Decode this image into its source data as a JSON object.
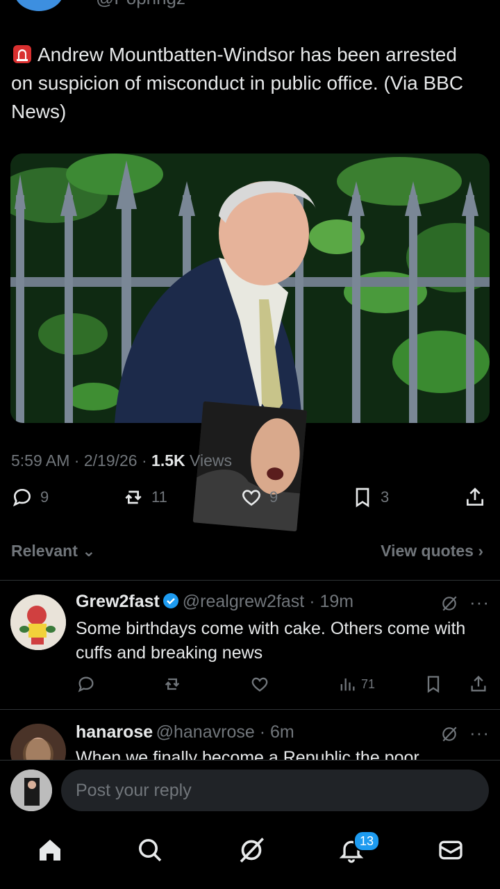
{
  "colors": {
    "background": "#000000",
    "text": "#e7e9ea",
    "muted": "#71767b",
    "accent": "#1d9bf0",
    "divider": "#2f3336"
  },
  "tweet": {
    "author_handle_partial": "@Popringz",
    "siren_icon": "police-siren-icon",
    "text": "Andrew Mountbatten-Windsor has been arrested on suspicion of misconduct in public office. (Via BBC News)",
    "time": "5:59 AM",
    "date": "2/19/26",
    "views_count": "1.5K",
    "views_label": "Views",
    "replies": "9",
    "reposts": "11",
    "likes": "9",
    "bookmarks": "3"
  },
  "sort": {
    "label": "Relevant",
    "view_quotes": "View quotes"
  },
  "replies": [
    {
      "name": "Grew2fast",
      "verified": true,
      "handle": "@realgrew2fast",
      "time": "19m",
      "text": "Some birthdays come with cake. Others come with cuffs and breaking news",
      "views": "71"
    },
    {
      "name": "hanarose",
      "handle": "@hanavrose",
      "time": "6m",
      "text": "When we finally become a Republic the poor"
    }
  ],
  "composer": {
    "placeholder": "Post your reply"
  },
  "nav": {
    "notifications_badge": "13"
  }
}
